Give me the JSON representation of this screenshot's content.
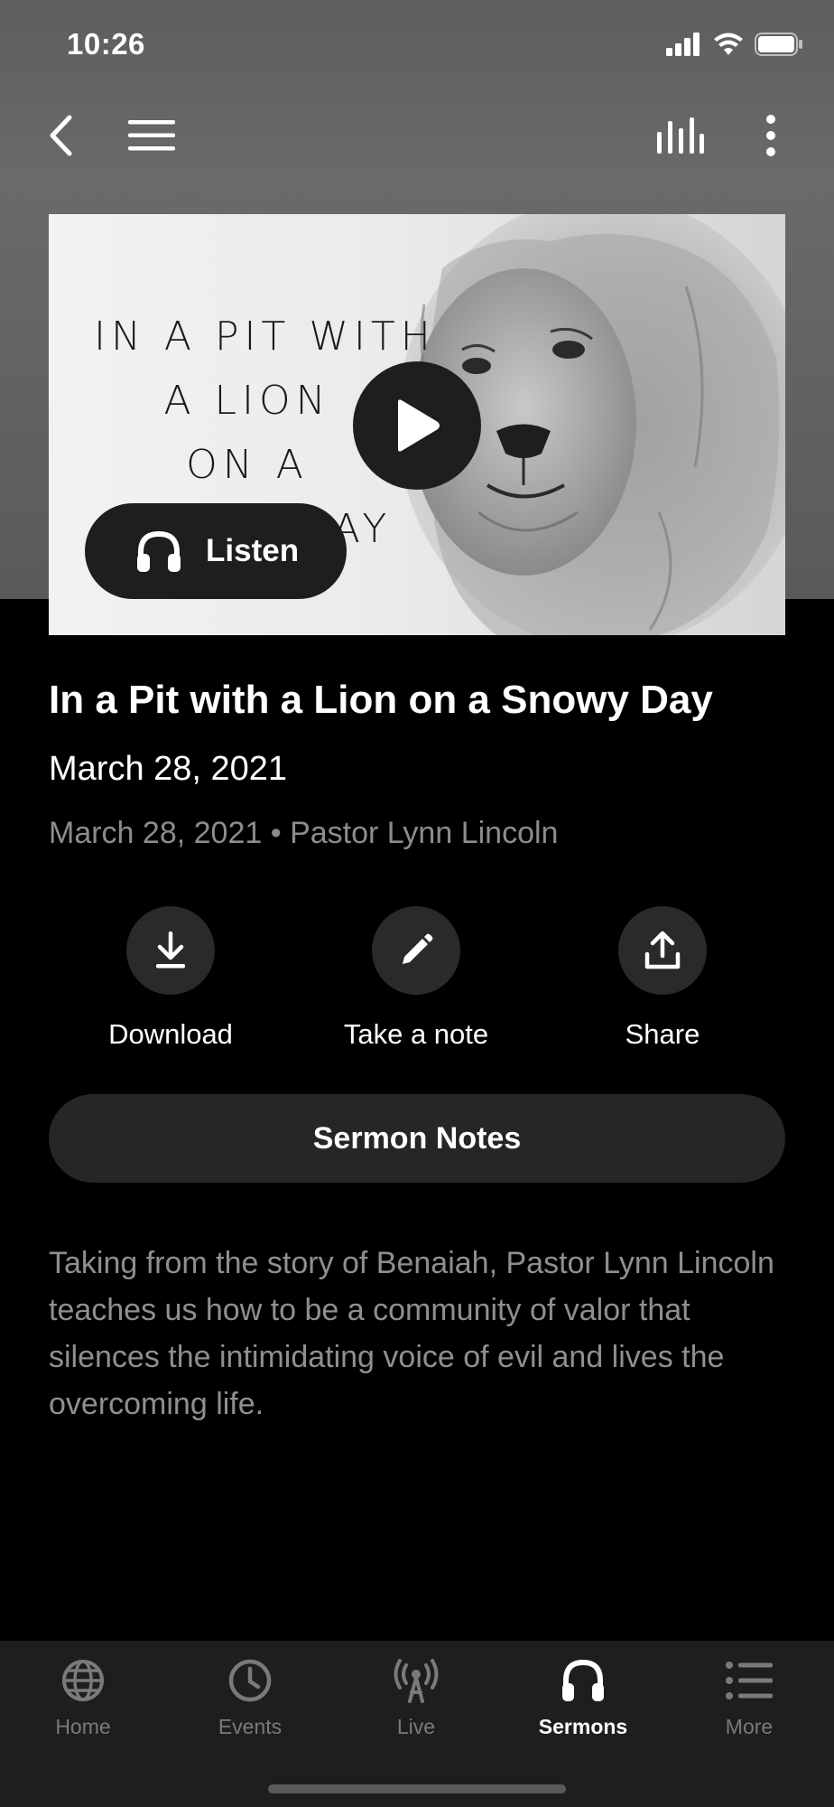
{
  "status_bar": {
    "time": "10:26"
  },
  "hero": {
    "title_lines": [
      "IN A PIT WITH",
      "A LION",
      "ON A",
      "SNOWY DAY"
    ],
    "listen_label": "Listen"
  },
  "sermon": {
    "title": "In a Pit with a Lion on a Snowy Day",
    "date": "March 28, 2021",
    "meta_date": "March 28, 2021",
    "separator": "•",
    "speaker": "Pastor Lynn Lincoln",
    "description": "Taking from the story of Benaiah, Pastor Lynn Lincoln teaches us how to be a community of valor that silences the intimidating voice of evil and lives the overcoming life."
  },
  "actions": [
    {
      "label": "Download",
      "icon": "download-icon"
    },
    {
      "label": "Take a note",
      "icon": "pencil-icon"
    },
    {
      "label": "Share",
      "icon": "share-icon"
    }
  ],
  "notes_button": {
    "label": "Sermon Notes"
  },
  "tabs": [
    {
      "label": "Home",
      "icon": "globe-icon",
      "active": false
    },
    {
      "label": "Events",
      "icon": "clock-icon",
      "active": false
    },
    {
      "label": "Live",
      "icon": "broadcast-icon",
      "active": false
    },
    {
      "label": "Sermons",
      "icon": "headphones-icon",
      "active": true
    },
    {
      "label": "More",
      "icon": "list-icon",
      "active": false
    }
  ],
  "colors": {
    "background": "#000000",
    "header_gray": "#636363",
    "button_dark": "#1e1e1e",
    "secondary_text": "#8c8c8c",
    "tab_inactive": "#7a7a7a",
    "tab_active": "#ffffff"
  }
}
